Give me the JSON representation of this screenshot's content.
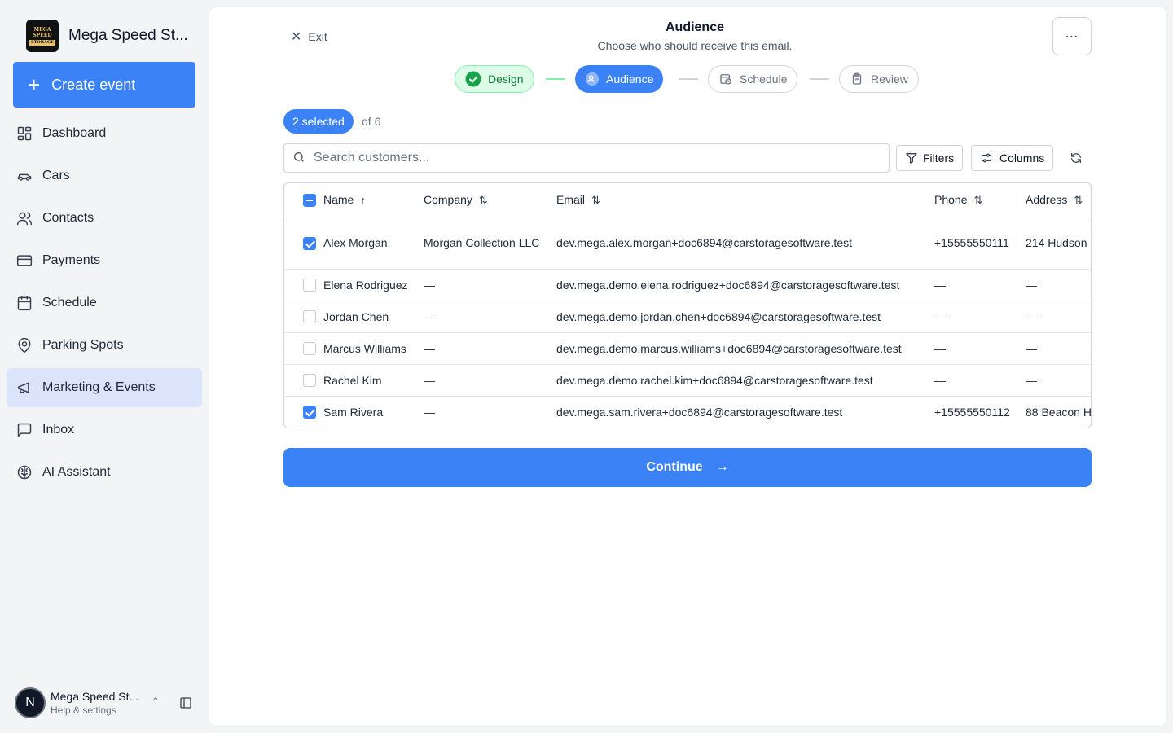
{
  "brand": {
    "name": "Mega Speed St...",
    "logo_line1": "MEGA SPEED",
    "logo_line2": "STORAGE"
  },
  "sidebar": {
    "create_label": "Create event",
    "items": [
      {
        "label": "Dashboard",
        "icon": "dashboard-icon",
        "active": false
      },
      {
        "label": "Cars",
        "icon": "car-icon",
        "active": false
      },
      {
        "label": "Contacts",
        "icon": "contacts-icon",
        "active": false
      },
      {
        "label": "Payments",
        "icon": "credit-card-icon",
        "active": false
      },
      {
        "label": "Schedule",
        "icon": "calendar-icon",
        "active": false
      },
      {
        "label": "Parking Spots",
        "icon": "map-pin-icon",
        "active": false
      },
      {
        "label": "Marketing & Events",
        "icon": "megaphone-icon",
        "active": true
      },
      {
        "label": "Inbox",
        "icon": "inbox-icon",
        "active": false
      },
      {
        "label": "AI Assistant",
        "icon": "brain-icon",
        "active": false
      }
    ],
    "user": {
      "initial": "N",
      "name": "Mega Speed St...",
      "subtitle": "Help & settings"
    }
  },
  "header": {
    "exit_label": "Exit",
    "title": "Audience",
    "subtitle": "Choose who should receive this email.",
    "more_label": "⋯"
  },
  "steps": [
    {
      "label": "Design",
      "state": "done",
      "icon": "check-circle-icon"
    },
    {
      "label": "Audience",
      "state": "current",
      "icon": "users-icon"
    },
    {
      "label": "Schedule",
      "state": "todo",
      "icon": "calendar-clock-icon"
    },
    {
      "label": "Review",
      "state": "todo",
      "icon": "clipboard-icon"
    }
  ],
  "selection": {
    "selected_label": "2 selected",
    "total_label": "of 6"
  },
  "search": {
    "placeholder": "Search customers...",
    "value": ""
  },
  "toolbar": {
    "filters_label": "Filters",
    "columns_label": "Columns"
  },
  "table": {
    "columns": [
      "Name",
      "Company",
      "Email",
      "Phone",
      "Address"
    ],
    "rows": [
      {
        "checked": true,
        "name": "Alex Morgan",
        "company": "Morgan Collection LLC",
        "email": "dev.mega.alex.morgan+doc6894@carstoragesoftware.test",
        "phone": "+15555550111",
        "address": "214 Hudson"
      },
      {
        "checked": false,
        "name": "Elena Rodriguez",
        "company": "—",
        "email": "dev.mega.demo.elena.rodriguez+doc6894@carstoragesoftware.test",
        "phone": "—",
        "address": "—"
      },
      {
        "checked": false,
        "name": "Jordan Chen",
        "company": "—",
        "email": "dev.mega.demo.jordan.chen+doc6894@carstoragesoftware.test",
        "phone": "—",
        "address": "—"
      },
      {
        "checked": false,
        "name": "Marcus Williams",
        "company": "—",
        "email": "dev.mega.demo.marcus.williams+doc6894@carstoragesoftware.test",
        "phone": "—",
        "address": "—"
      },
      {
        "checked": false,
        "name": "Rachel Kim",
        "company": "—",
        "email": "dev.mega.demo.rachel.kim+doc6894@carstoragesoftware.test",
        "phone": "—",
        "address": "—"
      },
      {
        "checked": true,
        "name": "Sam Rivera",
        "company": "—",
        "email": "dev.mega.sam.rivera+doc6894@carstoragesoftware.test",
        "phone": "+15555550112",
        "address": "88 Beacon H"
      }
    ]
  },
  "continue_label": "Continue",
  "colors": {
    "accent": "#3b82f6",
    "active_nav": "#dbe4fb",
    "done_step": "#dcfce7"
  }
}
